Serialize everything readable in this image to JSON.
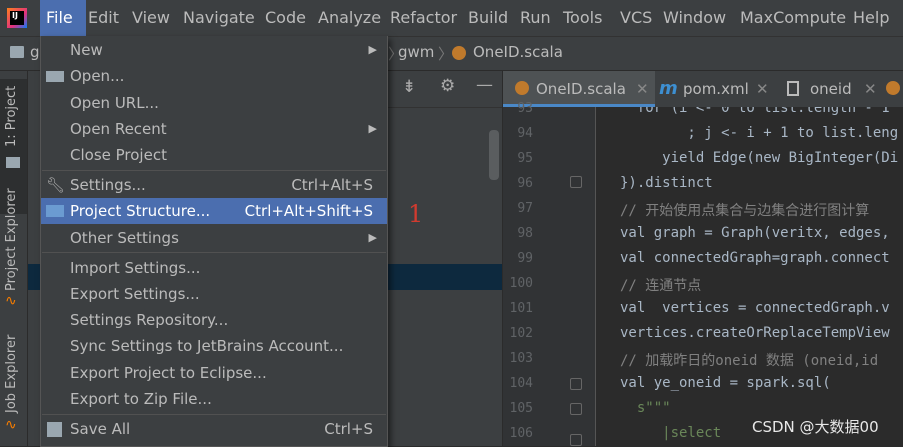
{
  "menubar": {
    "items": [
      "File",
      "Edit",
      "View",
      "Navigate",
      "Code",
      "Analyze",
      "Refactor",
      "Build",
      "Run",
      "Tools",
      "VCS",
      "Window",
      "MaxCompute",
      "Help"
    ]
  },
  "navbar": {
    "breadcrumb_left": "g",
    "breadcrumb_mid": "gwm",
    "breadcrumb_file": "OneID.scala"
  },
  "toolstrip": {
    "project_tab": "1: Project",
    "project_explorer_tab": "Project Explorer",
    "job_explorer_tab": "Job Explorer"
  },
  "editor_tabs": [
    {
      "label": "OneID.scala",
      "icon": "scala-file-icon"
    },
    {
      "label": "pom.xml",
      "icon": "maven-icon"
    },
    {
      "label": "oneid",
      "icon": "file-icon"
    }
  ],
  "line_numbers": [
    "93",
    "94",
    "95",
    "96",
    "97",
    "98",
    "99",
    "100",
    "101",
    "102",
    "103",
    "104",
    "105",
    "106"
  ],
  "code_lines": [
    "  for (i <- 0 to list.length - 1",
    "        ; j <- i + 1 to list.leng",
    "     yield Edge(new BigInteger(Di",
    "}).distinct",
    "// 开始使用点集合与边集合进行图计算",
    "val graph = Graph(veritx, edges,",
    "val connectedGraph=graph.connect",
    "// 连通节点",
    "val  vertices = connectedGraph.v",
    "vertices.createOrReplaceTempView",
    "// 加载昨日的oneid 数据 (oneid,id",
    "val ye_oneid = spark.sql(",
    "  s\"\"\"",
    "     |select"
  ],
  "file_menu": {
    "new": "New",
    "open": "Open...",
    "open_url": "Open URL...",
    "open_recent": "Open Recent",
    "close_project": "Close Project",
    "settings": "Settings...",
    "settings_shortcut": "Ctrl+Alt+S",
    "project_structure": "Project Structure...",
    "project_structure_shortcut": "Ctrl+Alt+Shift+S",
    "other_settings": "Other Settings",
    "import_settings": "Import Settings...",
    "export_settings": "Export Settings...",
    "settings_repository": "Settings Repository...",
    "sync_settings": "Sync Settings to JetBrains Account...",
    "export_eclipse": "Export Project to Eclipse...",
    "export_zip": "Export to Zip File...",
    "save_all": "Save All",
    "save_all_shortcut": "Ctrl+S"
  },
  "annotation": "1",
  "watermark": "CSDN @大数据00",
  "colors": {
    "accent": "#4b6eaf",
    "annotation": "#d13b2f"
  }
}
